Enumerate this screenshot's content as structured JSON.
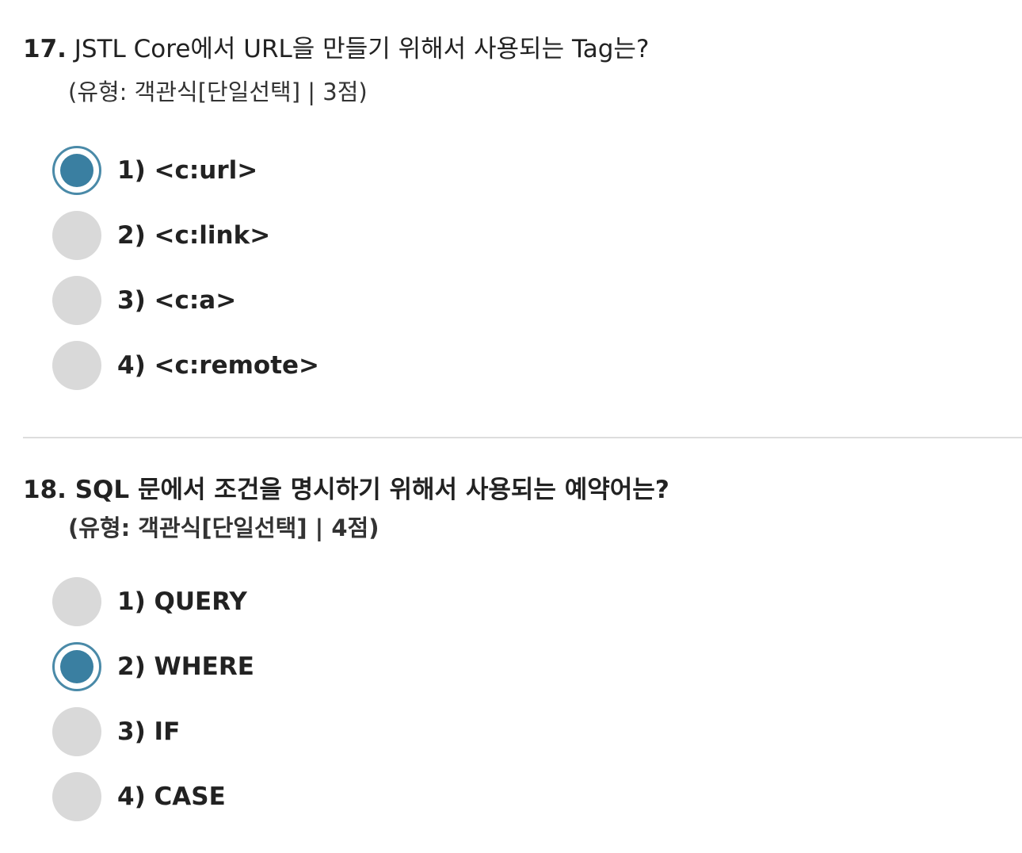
{
  "questions": [
    {
      "number": "17.",
      "text": "JSTL Core에서 URL을 만들기 위해서 사용되는 Tag는?",
      "meta": "(유형: 객관식[단일선택] | 3점)",
      "selected_index": 0,
      "options": [
        {
          "label": "1) <c:url>"
        },
        {
          "label": "2) <c:link>"
        },
        {
          "label": "3) <c:a>"
        },
        {
          "label": "4) <c:remote>"
        }
      ]
    },
    {
      "number": "18.",
      "text": "SQL 문에서 조건을 명시하기 위해서 사용되는 예약어는?",
      "meta": "(유형: 객관식[단일선택] | 4점)",
      "selected_index": 1,
      "options": [
        {
          "label": "1) QUERY"
        },
        {
          "label": "2) WHERE"
        },
        {
          "label": "3) IF"
        },
        {
          "label": "4) CASE"
        }
      ]
    }
  ],
  "colors": {
    "radio_selected": "#3a7fa1",
    "radio_ring": "#4a8aa8",
    "radio_unselected": "#d9d9d9",
    "divider": "#dddddd"
  }
}
